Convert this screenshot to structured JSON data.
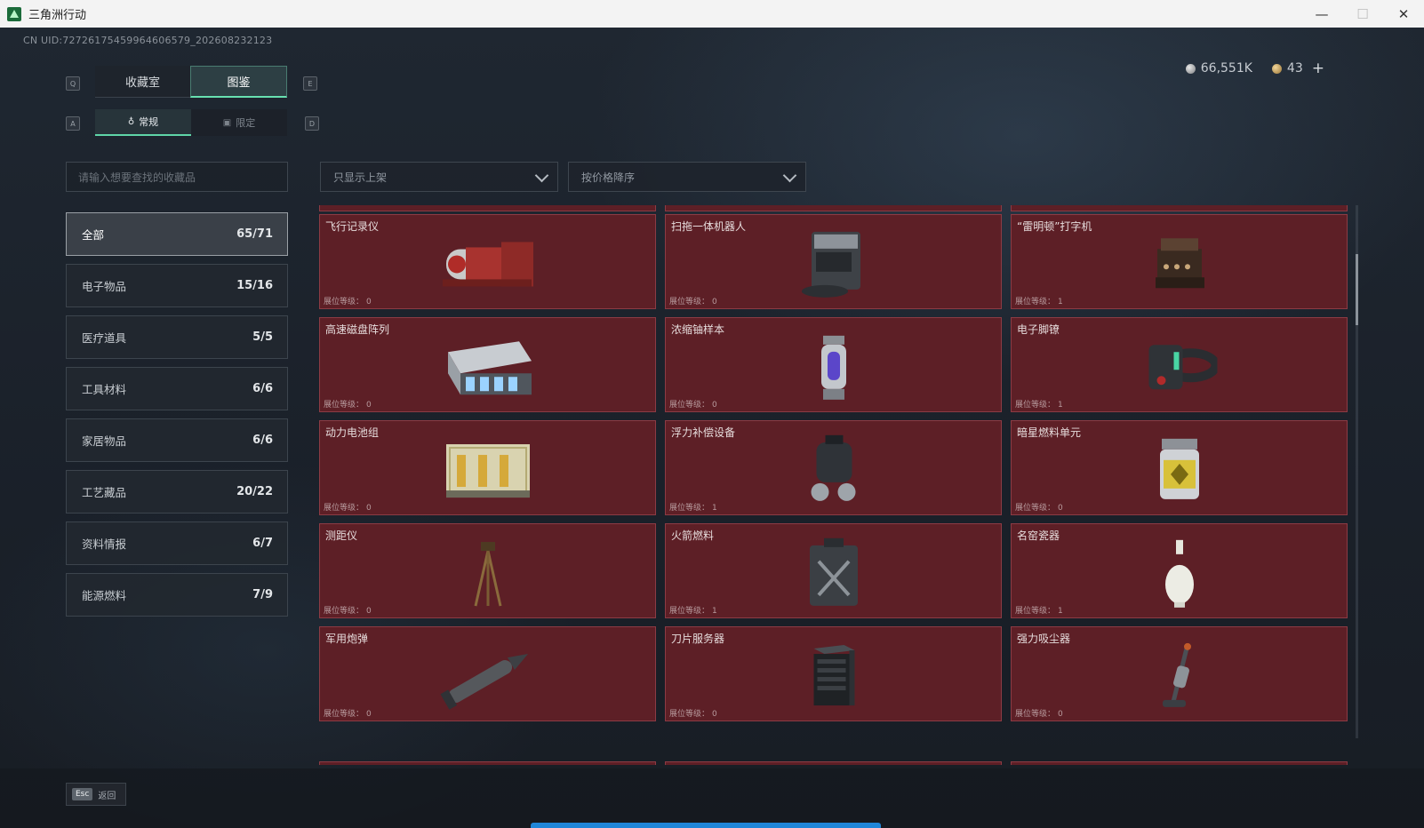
{
  "window": {
    "title": "三角洲行动",
    "minimize": "—",
    "maximize": "☐",
    "close": "✕"
  },
  "uid": "CN UID:7272617545996460​6579_202608232123",
  "currency": {
    "silver": "66,551K",
    "gold": "43",
    "add": "+"
  },
  "keys": {
    "q": "Q",
    "e": "E",
    "a": "A",
    "d": "D"
  },
  "tabs": [
    {
      "label": "收藏室",
      "active": false
    },
    {
      "label": "图鉴",
      "active": true
    }
  ],
  "subtabs": [
    {
      "label": "常规",
      "icon": "flask-icon",
      "active": true
    },
    {
      "label": "限定",
      "icon": "frame-icon",
      "active": false
    }
  ],
  "search": {
    "placeholder": "请输入想要查找的收藏品"
  },
  "filters": {
    "shelf": "只显示上架",
    "sort": "按价格降序"
  },
  "categories": [
    {
      "label": "全部",
      "count": "65/71",
      "active": true
    },
    {
      "label": "电子物品",
      "count": "15/16",
      "active": false
    },
    {
      "label": "医疗道具",
      "count": "5/5",
      "active": false
    },
    {
      "label": "工具材料",
      "count": "6/6",
      "active": false
    },
    {
      "label": "家居物品",
      "count": "6/6",
      "active": false
    },
    {
      "label": "工艺藏品",
      "count": "20/22",
      "active": false
    },
    {
      "label": "资料情报",
      "count": "6/7",
      "active": false
    },
    {
      "label": "能源燃料",
      "count": "7/9",
      "active": false
    }
  ],
  "level_label": "展位等级：",
  "items": [
    {
      "name": "飞行记录仪",
      "level": "0",
      "icon": "flight-recorder-icon"
    },
    {
      "name": "扫拖一体机器人",
      "level": "0",
      "icon": "robot-vacuum-icon"
    },
    {
      "name": "“雷明顿”打字机",
      "level": "1",
      "icon": "typewriter-icon"
    },
    {
      "name": "高速磁盘阵列",
      "level": "0",
      "icon": "disk-array-icon"
    },
    {
      "name": "浓缩铀样本",
      "level": "0",
      "icon": "uranium-sample-icon"
    },
    {
      "name": "电子脚镣",
      "level": "1",
      "icon": "ankle-monitor-icon"
    },
    {
      "name": "动力电池组",
      "level": "0",
      "icon": "battery-pack-icon"
    },
    {
      "name": "浮力补偿设备",
      "level": "1",
      "icon": "buoyancy-device-icon"
    },
    {
      "name": "暗星燃料单元",
      "level": "0",
      "icon": "fuel-cell-icon"
    },
    {
      "name": "测距仪",
      "level": "0",
      "icon": "rangefinder-icon"
    },
    {
      "name": "火箭燃料",
      "level": "1",
      "icon": "rocket-fuel-icon"
    },
    {
      "name": "名窑瓷器",
      "level": "1",
      "icon": "porcelain-vase-icon"
    },
    {
      "name": "军用炮弹",
      "level": "0",
      "icon": "artillery-shell-icon"
    },
    {
      "name": "刀片服务器",
      "level": "0",
      "icon": "blade-server-icon"
    },
    {
      "name": "强力吸尘器",
      "level": "0",
      "icon": "vacuum-cleaner-icon"
    }
  ],
  "footer": {
    "esc": "Esc",
    "back": "返回"
  }
}
